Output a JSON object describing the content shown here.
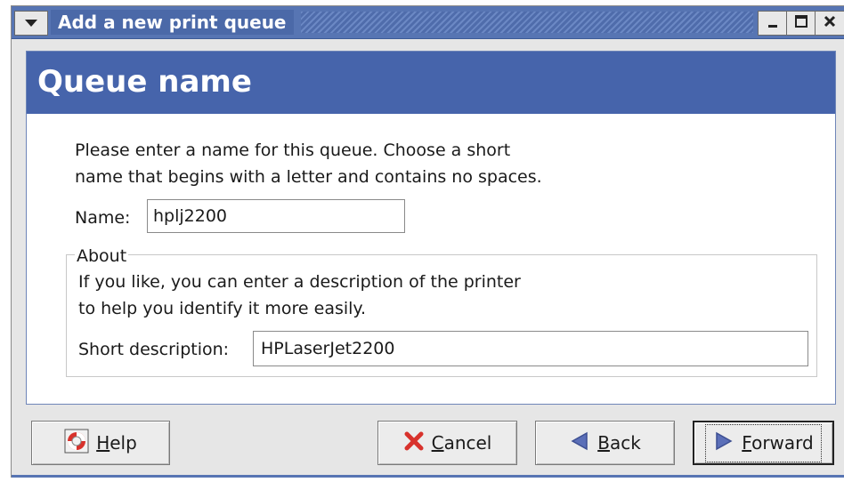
{
  "window": {
    "title": "Add a new print queue"
  },
  "header": {
    "title": "Queue name"
  },
  "instructions": {
    "line1": "Please enter a name for this queue.  Choose a short",
    "line2": "name that begins with a letter and contains no spaces."
  },
  "name_field": {
    "label": "Name:",
    "value": "hplj2200"
  },
  "about": {
    "legend": "About",
    "line1": "If you like, you can enter a description of the printer",
    "line2": "to help you identify it more easily.",
    "desc_label": "Short description:",
    "desc_value": "HPLaserJet2200"
  },
  "buttons": {
    "help_mnemonic": "H",
    "help_rest": "elp",
    "cancel_mnemonic": "C",
    "cancel_rest": "ancel",
    "back_mnemonic": "B",
    "back_rest": "ack",
    "forward_mnemonic": "F",
    "forward_rest": "orward"
  },
  "icons": {
    "window_menu": "chevron-down-icon",
    "minimize": "minimize-icon",
    "maximize": "maximize-icon",
    "close": "close-icon",
    "help": "lifebuoy-icon",
    "cancel": "cancel-x-icon",
    "back": "arrow-left-icon",
    "forward": "arrow-right-icon"
  },
  "colors": {
    "title_bar": "#5775b3",
    "header_band": "#4664ab",
    "cancel_icon": "#d8322c",
    "arrow_icon": "#5b6fb8"
  }
}
